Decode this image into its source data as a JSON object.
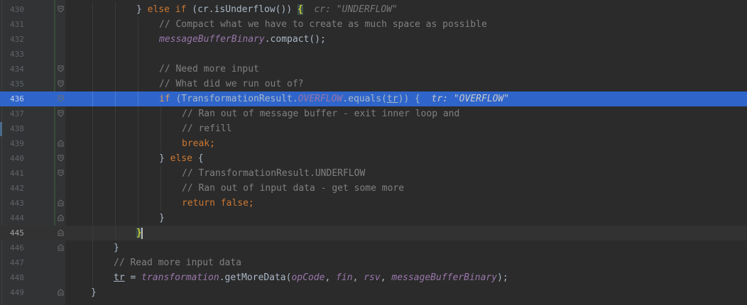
{
  "editor": {
    "language": "java",
    "caret_line": "445",
    "selected_line": "436",
    "lines": [
      {
        "n": "430",
        "indent": 3,
        "guides": [
          2,
          3
        ],
        "segs": [
          [
            "p",
            "} "
          ],
          [
            "kw",
            "else if"
          ],
          [
            "p",
            " (cr.isUnderflow()) "
          ],
          [
            "br",
            "{"
          ],
          [
            "p",
            "  "
          ],
          [
            "inl",
            "cr: \"UNDERFLOW\""
          ]
        ]
      },
      {
        "n": "431",
        "indent": 4,
        "guides": [
          2,
          3,
          4
        ],
        "segs": [
          [
            "cm",
            "// Compact what we have to create as much space as possible"
          ]
        ]
      },
      {
        "n": "432",
        "indent": 4,
        "guides": [
          2,
          3,
          4
        ],
        "segs": [
          [
            "fld",
            "messageBufferBinary"
          ],
          [
            "p",
            ".compact();"
          ]
        ]
      },
      {
        "n": "433",
        "indent": 0,
        "guides": [
          2,
          3,
          4
        ],
        "segs": []
      },
      {
        "n": "434",
        "indent": 4,
        "guides": [
          2,
          3,
          4
        ],
        "segs": [
          [
            "cm",
            "// Need more input"
          ]
        ]
      },
      {
        "n": "435",
        "indent": 4,
        "guides": [
          2,
          3,
          4
        ],
        "segs": [
          [
            "cm",
            "// What did we run out of?"
          ]
        ]
      },
      {
        "n": "436",
        "indent": 4,
        "guides": [
          2,
          3,
          4
        ],
        "segs": [
          [
            "kw",
            "if"
          ],
          [
            "p",
            " (TransformationResult."
          ],
          [
            "fld",
            "OVERFLOW"
          ],
          [
            "p",
            ".equals("
          ],
          [
            "ul",
            "tr"
          ],
          [
            "p",
            ")) {  "
          ],
          [
            "inl",
            "tr: \"OVERFLOW\""
          ]
        ]
      },
      {
        "n": "437",
        "indent": 5,
        "guides": [
          2,
          3,
          4,
          5
        ],
        "segs": [
          [
            "cm",
            "// Ran out of message buffer - exit inner loop and"
          ]
        ]
      },
      {
        "n": "438",
        "indent": 5,
        "guides": [
          2,
          3,
          4,
          5
        ],
        "segs": [
          [
            "cm",
            "// refill"
          ]
        ]
      },
      {
        "n": "439",
        "indent": 5,
        "guides": [
          2,
          3,
          4,
          5
        ],
        "segs": [
          [
            "kw",
            "break;"
          ]
        ]
      },
      {
        "n": "440",
        "indent": 4,
        "guides": [
          2,
          3,
          4
        ],
        "segs": [
          [
            "p",
            "} "
          ],
          [
            "kw",
            "else"
          ],
          [
            "p",
            " {"
          ]
        ]
      },
      {
        "n": "441",
        "indent": 5,
        "guides": [
          2,
          3,
          4,
          5
        ],
        "segs": [
          [
            "cm",
            "// TransformationResult.UNDERFLOW"
          ]
        ]
      },
      {
        "n": "442",
        "indent": 5,
        "guides": [
          2,
          3,
          4,
          5
        ],
        "segs": [
          [
            "cm",
            "// Ran out of input data - get some more"
          ]
        ]
      },
      {
        "n": "443",
        "indent": 5,
        "guides": [
          2,
          3,
          4,
          5
        ],
        "segs": [
          [
            "kw",
            "return false;"
          ]
        ]
      },
      {
        "n": "444",
        "indent": 4,
        "guides": [
          2,
          3,
          4
        ],
        "segs": [
          [
            "p",
            "}"
          ]
        ]
      },
      {
        "n": "445",
        "indent": 3,
        "guides": [
          2,
          3
        ],
        "segs": [
          [
            "br",
            "}"
          ],
          [
            "caret",
            ""
          ]
        ]
      },
      {
        "n": "446",
        "indent": 2,
        "guides": [
          2
        ],
        "segs": [
          [
            "p",
            "}"
          ]
        ]
      },
      {
        "n": "447",
        "indent": 2,
        "guides": [
          2
        ],
        "segs": [
          [
            "cm",
            "// Read more input data"
          ]
        ]
      },
      {
        "n": "448",
        "indent": 2,
        "guides": [
          2
        ],
        "segs": [
          [
            "ul",
            "tr"
          ],
          [
            "p",
            " = "
          ],
          [
            "fld",
            "transformation"
          ],
          [
            "p",
            ".getMoreData("
          ],
          [
            "fld",
            "opCode"
          ],
          [
            "p",
            ", "
          ],
          [
            "fld",
            "fin"
          ],
          [
            "p",
            ", "
          ],
          [
            "fld",
            "rsv"
          ],
          [
            "p",
            ", "
          ],
          [
            "fld",
            "messageBufferBinary"
          ],
          [
            "p",
            ");"
          ]
        ]
      },
      {
        "n": "449",
        "indent": 1,
        "guides": [],
        "segs": [
          [
            "p",
            "}"
          ]
        ]
      }
    ],
    "fold_markers": {
      "430": "open",
      "434": "open",
      "435": "open",
      "436": "open",
      "437": "open",
      "439": "close",
      "440": "open",
      "441": "open",
      "443": "close",
      "444": "close",
      "445": "close",
      "446": "close",
      "449": "close"
    }
  }
}
